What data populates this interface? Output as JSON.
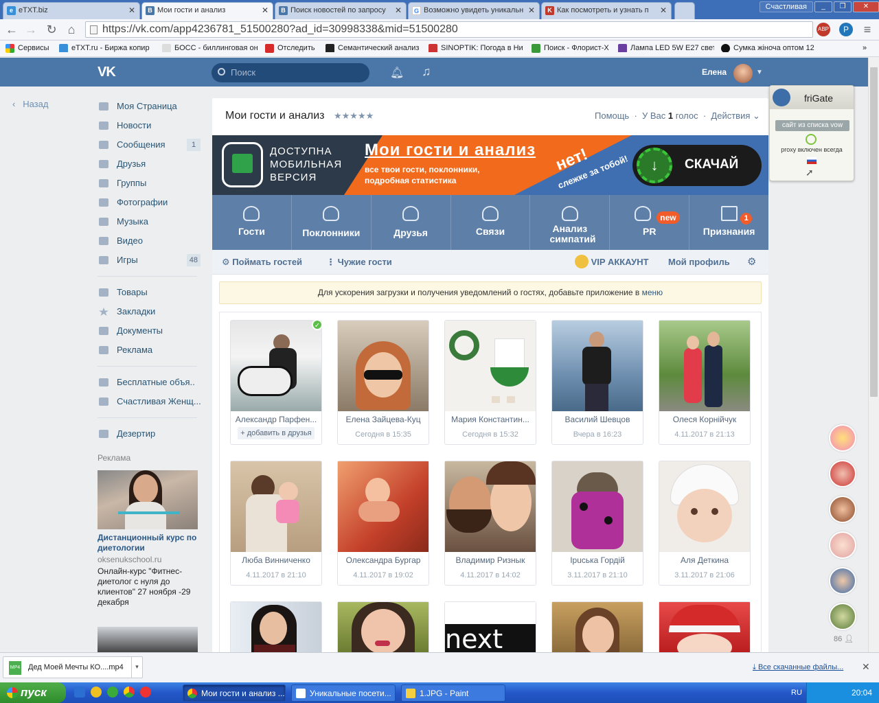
{
  "browser": {
    "tabs": [
      {
        "label": "eTXT.biz",
        "active": false
      },
      {
        "label": "Мои гости и анализ",
        "active": true
      },
      {
        "label": "Поиск новостей по запросу",
        "active": false
      },
      {
        "label": "Возможно увидеть уникальн",
        "active": false
      },
      {
        "label": "Как посмотреть и узнать п",
        "active": false
      }
    ],
    "profile": "Счастливая",
    "url": "https://vk.com/app4236781_51500280?ad_id=30998338&mid=51500280",
    "bookmarks": [
      "Сервисы",
      "eTXT.ru - Биржа копир",
      "БОСС - биллинговая он",
      "Отследить",
      "Семантический анализ",
      "SINOPTIK: Погода в Ни",
      "Поиск - Флорист-X",
      "Лампа LED 5W E27 свет",
      "Сумка жіноча оптом 12"
    ]
  },
  "vk": {
    "search_placeholder": "Поиск",
    "user_name": "Елена",
    "back": "Назад",
    "menu": [
      {
        "label": "Моя Страница",
        "count": ""
      },
      {
        "label": "Новости",
        "count": ""
      },
      {
        "label": "Сообщения",
        "count": "1"
      },
      {
        "label": "Друзья",
        "count": ""
      },
      {
        "label": "Группы",
        "count": ""
      },
      {
        "label": "Фотографии",
        "count": ""
      },
      {
        "label": "Музыка",
        "count": ""
      },
      {
        "label": "Видео",
        "count": ""
      },
      {
        "label": "Игры",
        "count": "48"
      }
    ],
    "menu2": [
      "Товары",
      "Закладки",
      "Документы",
      "Реклама"
    ],
    "menu3": [
      "Бесплатные объя..",
      "Счастливая Женщ..."
    ],
    "menu4": [
      "Дезертир"
    ],
    "ad": {
      "label": "Реклама",
      "title": "Дистанционный курс по диетологии",
      "domain": "oksenukschool.ru",
      "text": "Онлайн-курс \"Фитнес-диетолог с нуля до клиентов\" 27 ноября -29 декабря"
    }
  },
  "app": {
    "title": "Мои гости и анализ",
    "stars": "★★★★★",
    "help": "Помощь",
    "votes_prefix": "У Вас",
    "votes_count": "1",
    "votes_suffix": "голос",
    "actions": "Действия",
    "banner": {
      "mobile": "ДОСТУПНА МОБИЛЬНАЯ ВЕРСИЯ",
      "title": "Мои гости и анализ",
      "subtitle": "все твои гости, поклонники, подробная статистика",
      "net": "нет!",
      "spy": "слежке за тобой!",
      "download": "СКАЧАЙ"
    },
    "tabs": [
      {
        "label": "Гости",
        "badge": ""
      },
      {
        "label": "Поклонники",
        "badge": ""
      },
      {
        "label": "Друзья",
        "badge": ""
      },
      {
        "label": "Связи",
        "badge": ""
      },
      {
        "label": "Анализ симпатий",
        "badge": ""
      },
      {
        "label": "PR",
        "badge": "new"
      },
      {
        "label": "Признания",
        "badge": "1"
      }
    ],
    "subtabs": {
      "catch": "Поймать гостей",
      "foreign": "Чужие гости",
      "vip": "VIP АККАУНТ",
      "profile": "Мой профиль"
    },
    "notice_text": "Для ускорения загрузки и получения уведомлений о гостях, добавьте приложение в",
    "notice_link": "меню",
    "add_friend": "+ добавить в друзья",
    "guests": [
      {
        "name": "Александр Парфен...",
        "time": ""
      },
      {
        "name": "Елена Зайцева-Куц",
        "time": "Сегодня в 15:35"
      },
      {
        "name": "Мария Константин...",
        "time": "Сегодня в 15:32"
      },
      {
        "name": "Василий Шевцов",
        "time": "Вчера в 16:23"
      },
      {
        "name": "Олеся Корнійчук",
        "time": "4.11.2017 в 21:13"
      },
      {
        "name": "Люба Винниченко",
        "time": "4.11.2017 в 21:10"
      },
      {
        "name": "Олександра Бургар",
        "time": "4.11.2017 в 19:02"
      },
      {
        "name": "Владимир Ризнык",
        "time": "4.11.2017 в 14:02"
      },
      {
        "name": "Ірuська Гордій",
        "time": "3.11.2017 в 21:10"
      },
      {
        "name": "Аля Деткина",
        "time": "3.11.2017 в 21:06"
      }
    ],
    "next_text": "next"
  },
  "frigate": {
    "name": "friGate",
    "list": "сайт из списка vow",
    "proxy": "proxy включен всегда"
  },
  "friends_count": "86",
  "downloads": {
    "file": "Дед Моей Мечты КО....mp4",
    "all": "Все скачанные файлы..."
  },
  "taskbar": {
    "start": "пуск",
    "items": [
      "Мои гости и анализ ...",
      "Уникальные посети...",
      "1.JPG - Paint"
    ],
    "lang": "RU",
    "clock": "20:04"
  }
}
